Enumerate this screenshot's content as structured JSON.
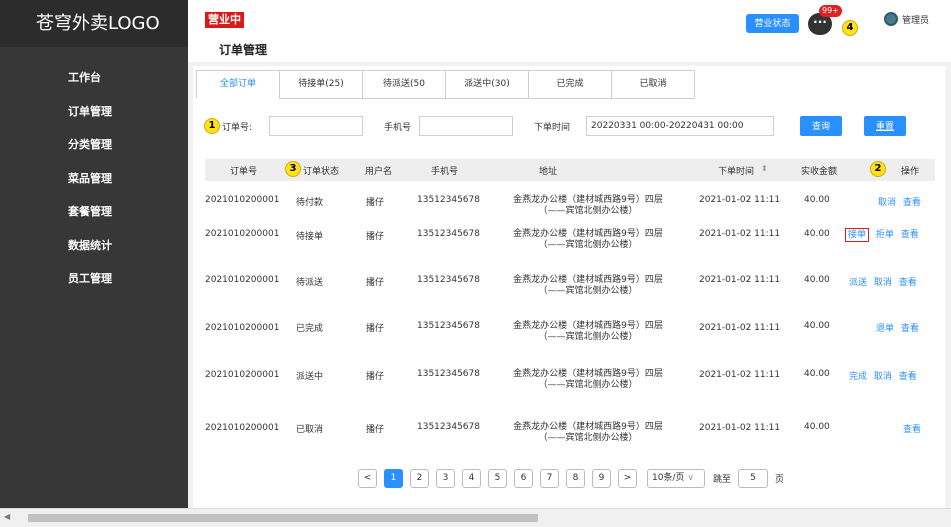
{
  "logo": "苍穹外卖LOGO",
  "sidebar": {
    "items": [
      {
        "label": "工作台"
      },
      {
        "label": "订单管理"
      },
      {
        "label": "分类管理"
      },
      {
        "label": "菜品管理"
      },
      {
        "label": "套餐管理"
      },
      {
        "label": "数据统计"
      },
      {
        "label": "员工管理"
      }
    ]
  },
  "header": {
    "status_badge": "营业中",
    "page_title": "订单管理",
    "shop_status_button": "营业状态",
    "message_icon_glyph": "···",
    "message_count": "99+",
    "admin_name": "管理员"
  },
  "callouts": [
    "1",
    "2",
    "3",
    "4"
  ],
  "tabs": [
    {
      "label": "全部订单",
      "active": true
    },
    {
      "label": "待接单(25)"
    },
    {
      "label": "待派送(50"
    },
    {
      "label": "派送中(30)"
    },
    {
      "label": "已完成"
    },
    {
      "label": "已取消"
    }
  ],
  "filter": {
    "order_no_label": "订单号:",
    "order_no_value": "",
    "phone_label": "手机号",
    "phone_value": "",
    "time_label": "下单时间",
    "time_value": "20220331 00:00-20220431 00:00",
    "query_button": "查询",
    "reset_button": "重置"
  },
  "table": {
    "headers": {
      "order_no": "订单号",
      "status": "订单状态",
      "user": "用户名",
      "phone": "手机号",
      "address": "地址",
      "time": "下单时间",
      "sort_icon": "⬍",
      "amount": "实收金额",
      "ops": "操作"
    },
    "rows": [
      {
        "order_no": "2021010200001",
        "status": "待付款",
        "user": "播仔",
        "phone": "13512345678",
        "addr1": "金燕龙办公楼（建材城西路9号）四层",
        "addr2": "（——宾馆北侧办公楼）",
        "time": "2021-01-02 11:11",
        "amount": "40.00",
        "actions": [
          "取消",
          "查看"
        ]
      },
      {
        "order_no": "2021010200001",
        "status": "待接单",
        "user": "播仔",
        "phone": "13512345678",
        "addr1": "金燕龙办公楼（建材城西路9号）四层",
        "addr2": "（——宾馆北侧办公楼）",
        "time": "2021-01-02 11:11",
        "amount": "40.00",
        "actions": [
          "接单",
          "拒单",
          "查看"
        ]
      },
      {
        "order_no": "2021010200001",
        "status": "待派送",
        "user": "播仔",
        "phone": "13512345678",
        "addr1": "金燕龙办公楼（建材城西路9号）四层",
        "addr2": "（——宾馆北侧办公楼）",
        "time": "2021-01-02 11:11",
        "amount": "40.00",
        "actions": [
          "派送",
          "取消",
          "查看"
        ]
      },
      {
        "order_no": "2021010200001",
        "status": "已完成",
        "user": "播仔",
        "phone": "13512345678",
        "addr1": "金燕龙办公楼（建材城西路9号）四层",
        "addr2": "（——宾馆北侧办公楼）",
        "time": "2021-01-02 11:11",
        "amount": "40.00",
        "actions": [
          "退单",
          "查看"
        ]
      },
      {
        "order_no": "2021010200001",
        "status": "派送中",
        "user": "播仔",
        "phone": "13512345678",
        "addr1": "金燕龙办公楼（建材城西路9号）四层",
        "addr2": "（——宾馆北侧办公楼）",
        "time": "2021-01-02 11:11",
        "amount": "40.00",
        "actions": [
          "完成",
          "取消",
          "查看"
        ]
      },
      {
        "order_no": "2021010200001",
        "status": "已取消",
        "user": "播仔",
        "phone": "13512345678",
        "addr1": "金燕龙办公楼（建材城西路9号）四层",
        "addr2": "（——宾馆北侧办公楼）",
        "time": "2021-01-02 11:11",
        "amount": "40.00",
        "actions": [
          "查看"
        ]
      }
    ]
  },
  "pagination": {
    "prev": "<",
    "next": ">",
    "pages": [
      "1",
      "2",
      "3",
      "4",
      "5",
      "6",
      "7",
      "8",
      "9"
    ],
    "current": "1",
    "page_size": "10条/页",
    "jump_label": "跳至",
    "jump_value": "5",
    "page_suffix": "页"
  },
  "scrollbar": {
    "left_arrow": "◀"
  },
  "colors": {
    "accent": "#2b90ff",
    "badge": "#d71a1b",
    "sidebar": "#373737"
  }
}
